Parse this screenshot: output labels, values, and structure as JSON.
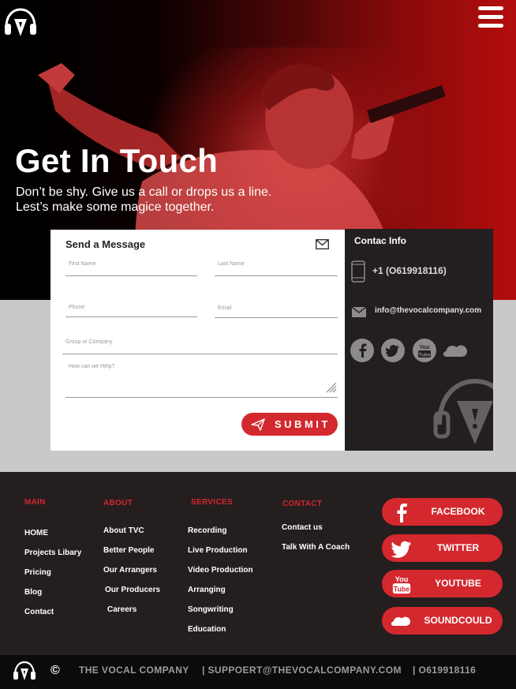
{
  "hero": {
    "title": "Get In Touch",
    "subtitle_line1": "Don’t be shy. Give us a call or drops us a line.",
    "subtitle_line2": "Lest’s make some magice together."
  },
  "form": {
    "title": "Send a Message",
    "fields": {
      "first_name": "First Name",
      "last_name": "Last Name",
      "phone": "Phone",
      "email": "Email",
      "group": "Group or Company",
      "help": "How can we Help?"
    },
    "submit_label": "SUBMIT"
  },
  "contact_info": {
    "title": "Contac Info",
    "phone": "+1 (O619918116)",
    "email": "info@thevocalcompany.com",
    "social_icons": [
      "facebook-icon",
      "twitter-icon",
      "youtube-icon",
      "soundcloud-icon"
    ]
  },
  "footer": {
    "main": {
      "heading": "MAIN",
      "links": [
        "HOME",
        "Projects Libary",
        "Pricing",
        "Blog",
        "Contact"
      ]
    },
    "about": {
      "heading": "ABOUT",
      "links": [
        "About TVC",
        "Better People",
        "Our Arrangers",
        "Our  Producers",
        "Careers"
      ]
    },
    "services": {
      "heading": "SERVICES",
      "links": [
        "Recording",
        "Live Production",
        "Video Production",
        "Arranging",
        "Songwriting",
        "Education"
      ]
    },
    "contact": {
      "heading": "CONTACT",
      "links": [
        "Contact us",
        "Talk  With A Coach"
      ]
    },
    "social_buttons": [
      "FACEBOOK",
      "TWITTER",
      "YOUTUBE",
      "SOUNDCOULD"
    ]
  },
  "bottom_bar": {
    "company": "THE  VOCAL COMPANY",
    "email": "| SUPPOERT@THEVOCALCOMPANY.COM",
    "phone": "| O619918116"
  },
  "colors": {
    "accent": "#d3282e",
    "footer_bg": "#241e1f",
    "info_bg": "#231f20",
    "band": "#c9c9c9"
  }
}
